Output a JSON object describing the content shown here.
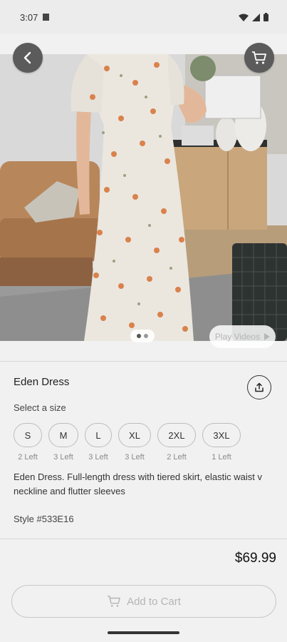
{
  "status_bar": {
    "time": "3:07"
  },
  "hero": {
    "play_videos_label": "Play Videos",
    "pager_total": 2,
    "pager_current": 1
  },
  "product": {
    "name": "Eden Dress",
    "select_size_label": "Select a size",
    "sizes": [
      {
        "label": "S",
        "stock": "2 Left"
      },
      {
        "label": "M",
        "stock": "3 Left"
      },
      {
        "label": "L",
        "stock": "3 Left"
      },
      {
        "label": "XL",
        "stock": "3 Left"
      },
      {
        "label": "2XL",
        "stock": "2 Left"
      },
      {
        "label": "3XL",
        "stock": "1 Left"
      }
    ],
    "description": "Eden Dress. Full-length dress with tiered skirt, elastic waist v neckline and flutter sleeves",
    "style": "Style #533E16",
    "price": "$69.99"
  },
  "actions": {
    "add_to_cart_label": "Add to Cart"
  },
  "colors": {
    "background": "#f1f1f1",
    "disabled_text": "#b5b5b5",
    "overlay_button": "#5b5b5b"
  }
}
